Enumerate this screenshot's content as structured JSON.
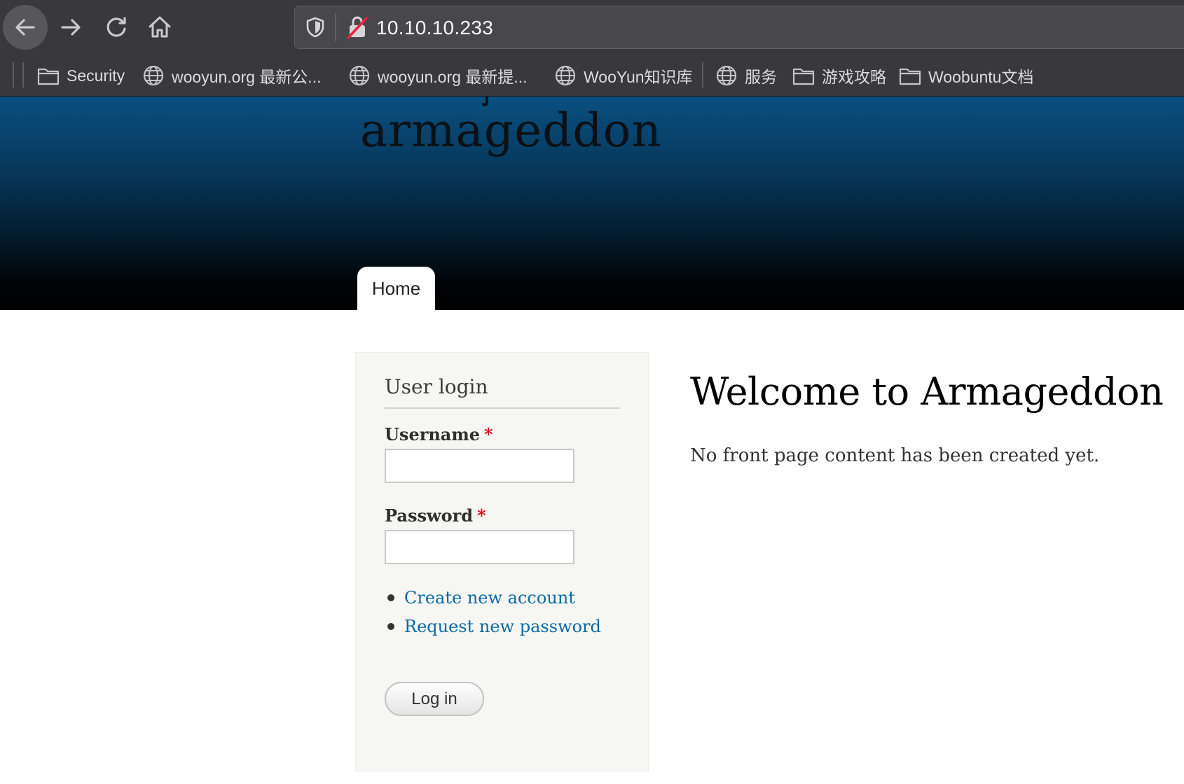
{
  "browser": {
    "url": "10.10.10.233",
    "bookmarks": [
      {
        "label": "Security",
        "icon": "folder-icon"
      },
      {
        "label": "wooyun.org 最新公...",
        "icon": "globe-icon"
      },
      {
        "label": "wooyun.org 最新提...",
        "icon": "globe-icon"
      },
      {
        "label": "WooYun知识库",
        "icon": "globe-icon"
      },
      {
        "label": "服务",
        "icon": "globe-icon"
      },
      {
        "label": "游戏攻略",
        "icon": "folder-icon"
      },
      {
        "label": "Woobuntu文档",
        "icon": "folder-icon"
      }
    ]
  },
  "site": {
    "name": "armageddon",
    "nav": {
      "home_label": "Home"
    }
  },
  "login": {
    "title": "User login",
    "username_label": "Username",
    "username_value": "",
    "password_label": "Password",
    "password_value": "",
    "required_marker": "*",
    "links": [
      "Create new account",
      "Request new password"
    ],
    "submit_label": "Log in"
  },
  "main": {
    "title": "Welcome to Armageddon",
    "text": "No front page content has been created yet."
  },
  "colors": {
    "chrome_bg": "#38383d",
    "link": "#0b6aa3",
    "required": "#e2001a"
  }
}
